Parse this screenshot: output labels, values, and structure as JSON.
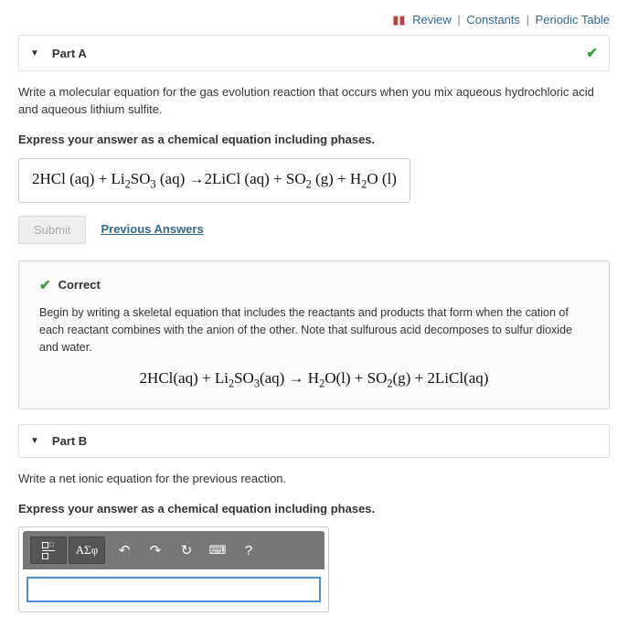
{
  "topLinks": {
    "review": "Review",
    "constants": "Constants",
    "periodic": "Periodic Table"
  },
  "partA": {
    "title": "Part A",
    "question": "Write a molecular equation for the gas evolution reaction that occurs when you mix aqueous hydrochloric acid and aqueous lithium sulfite.",
    "instruction": "Express your answer as a chemical equation including phases.",
    "answer_equation": {
      "lhs": [
        {
          "coef": "2",
          "formula": "HCl",
          "phase": "(aq)"
        },
        {
          "coef": "",
          "formula": "Li2SO3",
          "phase": "(aq)"
        }
      ],
      "rhs": [
        {
          "coef": "2",
          "formula": "LiCl",
          "phase": "(aq)"
        },
        {
          "coef": "",
          "formula": "SO2",
          "phase": "(g)"
        },
        {
          "coef": "",
          "formula": "H2O",
          "phase": "(l)"
        }
      ]
    },
    "submit_label": "Submit",
    "prev_answers": "Previous Answers",
    "feedback": {
      "status": "Correct",
      "explanation": "Begin by writing a skeletal equation that includes the reactants and products that form when the cation of each reactant combines with the anion of the other. Note that sulfurous acid decomposes to sulfur dioxide and water.",
      "equation": {
        "lhs": [
          {
            "coef": "2",
            "formula": "HCl",
            "phase": "(aq)"
          },
          {
            "coef": "",
            "formula": "Li2SO3",
            "phase": "(aq)"
          }
        ],
        "rhs": [
          {
            "coef": "",
            "formula": "H2O",
            "phase": "(l)"
          },
          {
            "coef": "",
            "formula": "SO2",
            "phase": "(g)"
          },
          {
            "coef": "2",
            "formula": "LiCl",
            "phase": "(aq)"
          }
        ]
      }
    }
  },
  "partB": {
    "title": "Part B",
    "question": "Write a net ionic equation for the previous reaction.",
    "instruction": "Express your answer as a chemical equation including phases.",
    "editor": {
      "value": "",
      "toolbar": {
        "template": "x^y/z",
        "greek": "ΑΣφ",
        "undo": "↶",
        "redo": "↷",
        "reset": "↻",
        "keyboard": "⌨",
        "help": "?"
      }
    }
  }
}
